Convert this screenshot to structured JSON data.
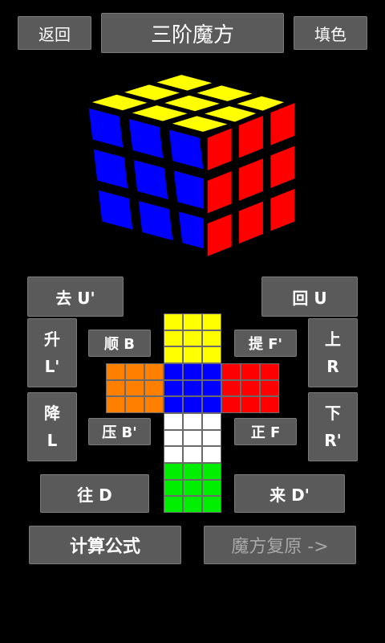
{
  "header": {
    "back_label": "返回",
    "title": "三阶魔方",
    "fill_label": "填色"
  },
  "colors": {
    "yellow": "#ffff00",
    "blue": "#0000ff",
    "red": "#ff0000",
    "orange": "#ff7f00",
    "white": "#ffffff",
    "green": "#00ee00",
    "button_bg": "#5a5a5a"
  },
  "moves": {
    "u_prime": "去 U'",
    "u": "回 U",
    "l_prime": "升\nL'",
    "l": "降\nL",
    "r": "上\nR",
    "r_prime": "下\nR'",
    "b": "顺 B",
    "b_prime": "压 B'",
    "f_prime": "提 F'",
    "f": "正 F",
    "d": "往 D",
    "d_prime": "来 D'"
  },
  "net": {
    "up": "yellow",
    "left": "orange",
    "front": "blue",
    "right": "red",
    "down": "white",
    "back": "green"
  },
  "cube_3d": {
    "top": "yellow",
    "front": "blue",
    "right": "red"
  },
  "footer": {
    "calc_label": "计算公式",
    "solve_label": "魔方复原 ->"
  }
}
